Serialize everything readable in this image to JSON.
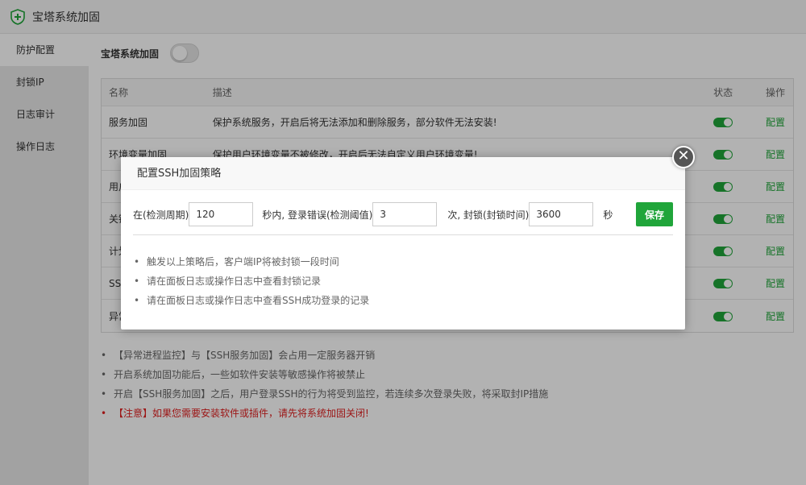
{
  "window": {
    "title": "宝塔系统加固",
    "logo_icon": "shield-icon"
  },
  "sidebar": {
    "items": [
      {
        "label": "防护配置",
        "active": true
      },
      {
        "label": "封锁IP",
        "active": false
      },
      {
        "label": "日志审计",
        "active": false
      },
      {
        "label": "操作日志",
        "active": false
      }
    ]
  },
  "main": {
    "toggle_label": "宝塔系统加固",
    "toggle_state": "off",
    "table": {
      "headers": {
        "name": "名称",
        "desc": "描述",
        "state": "状态",
        "op": "操作"
      },
      "rows": [
        {
          "name": "服务加固",
          "desc": "保护系统服务，开启后将无法添加和删除服务，部分软件无法安装!",
          "state": "on",
          "op": "配置"
        },
        {
          "name": "环境变量加固",
          "desc": "保护用户环境变量不被修改，开启后无法自定义用户环境变量!",
          "state": "on",
          "op": "配置"
        },
        {
          "name": "用户",
          "desc": "",
          "state": "on",
          "op": "配置"
        },
        {
          "name": "关键",
          "desc": "",
          "state": "on",
          "op": "配置"
        },
        {
          "name": "计划",
          "desc": "",
          "state": "on",
          "op": "配置"
        },
        {
          "name": "SSH",
          "desc": "",
          "state": "on",
          "op": "配置"
        },
        {
          "name": "异常",
          "desc": "",
          "state": "on",
          "op": "配置"
        }
      ]
    },
    "notes": [
      "【异常进程监控】与【SSH服务加固】会占用一定服务器开销",
      "开启系统加固功能后，一些如软件安装等敏感操作将被禁止",
      "开启【SSH服务加固】之后，用户登录SSH的行为将受到监控，若连续多次登录失败，将采取封IP措施"
    ],
    "warning": "【注意】如果您需要安装软件或插件，请先将系统加固关闭!"
  },
  "dialog": {
    "title": "配置SSH加固策略",
    "close_icon": "close-icon",
    "label_period": "在(检测周期)",
    "period_value": "120",
    "label_threshold": "秒内, 登录错误(检测阈值)",
    "threshold_value": "3",
    "label_ban": "次, 封锁(封锁时间)",
    "ban_value": "3600",
    "label_unit": "秒",
    "save_label": "保存",
    "tips": [
      "触发以上策略后，客户端IP将被封锁一段时间",
      "请在面板日志或操作日志中查看封锁记录",
      "请在面板日志或操作日志中查看SSH成功登录的记录"
    ]
  },
  "colors": {
    "accent": "#20a53a",
    "warning": "#e02020"
  }
}
